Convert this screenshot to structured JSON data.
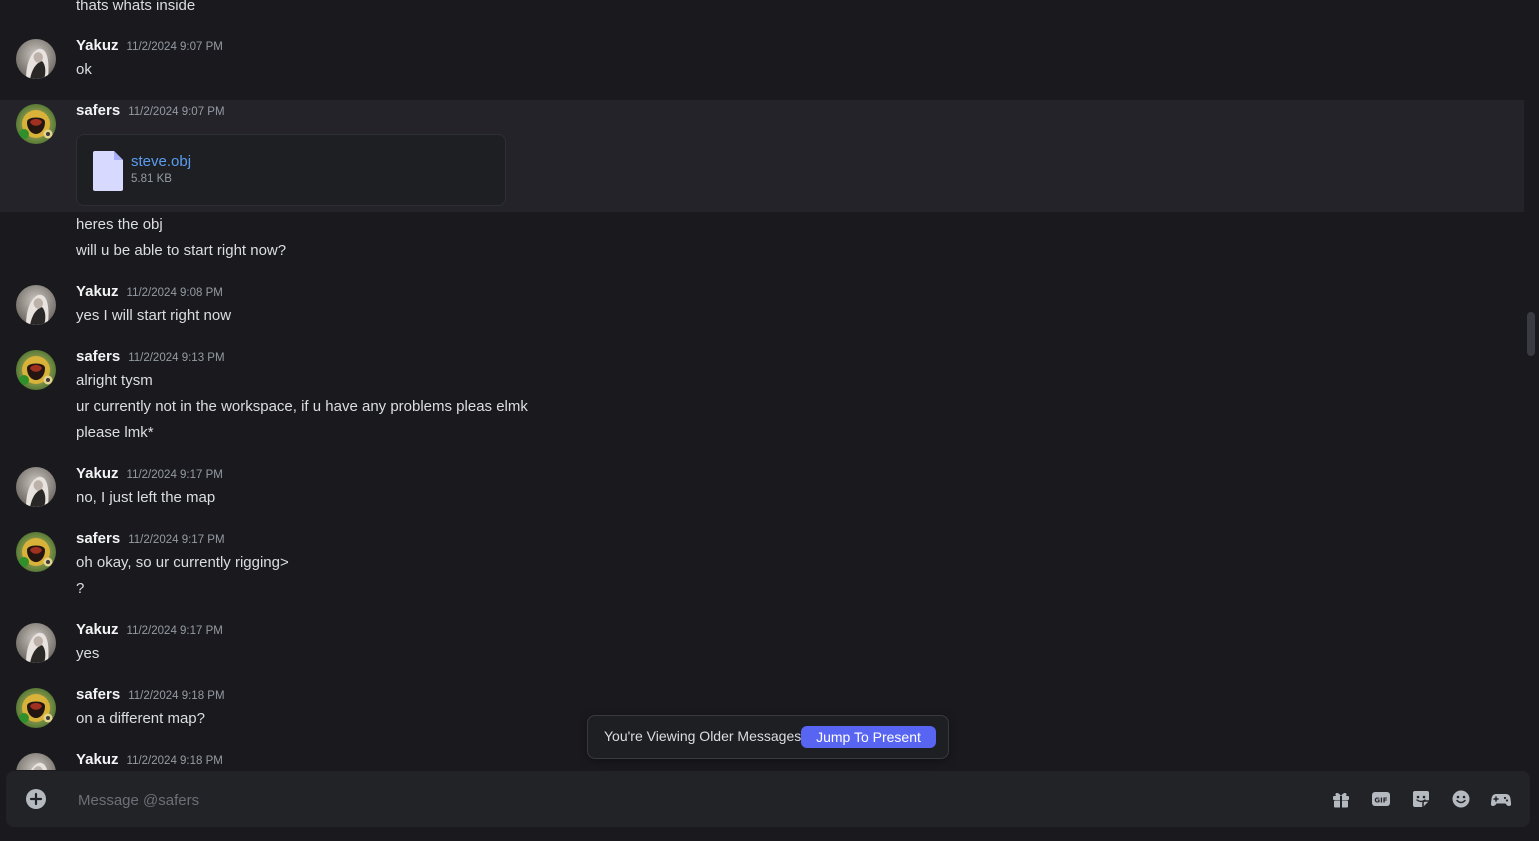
{
  "messages": {
    "m0": {
      "line1": "thats whats inside"
    },
    "m1": {
      "username": "Yakuz",
      "timestamp": "11/2/2024 9:07 PM",
      "line1": "ok"
    },
    "m2": {
      "username": "safers",
      "timestamp": "11/2/2024 9:07 PM",
      "attachment": {
        "name": "steve.obj",
        "size": "5.81 KB"
      },
      "line1": "heres the obj",
      "line2": "will u be able to start right now?"
    },
    "m3": {
      "username": "Yakuz",
      "timestamp": "11/2/2024 9:08 PM",
      "line1": "yes I will start right now"
    },
    "m4": {
      "username": "safers",
      "timestamp": "11/2/2024 9:13 PM",
      "line1": "alright tysm",
      "line2": "ur currently not in the workspace, if u have any problems pleas elmk",
      "line3": "please lmk*"
    },
    "m5": {
      "username": "Yakuz",
      "timestamp": "11/2/2024 9:17 PM",
      "line1": "no, I just left the map"
    },
    "m6": {
      "username": "safers",
      "timestamp": "11/2/2024 9:17 PM",
      "line1": "oh okay, so ur currently rigging>",
      "line2": "?"
    },
    "m7": {
      "username": "Yakuz",
      "timestamp": "11/2/2024 9:17 PM",
      "line1": "yes"
    },
    "m8": {
      "username": "safers",
      "timestamp": "11/2/2024 9:18 PM",
      "line1": "on a different map?"
    },
    "m9": {
      "username": "Yakuz",
      "timestamp": "11/2/2024 9:18 PM"
    }
  },
  "older_messages": {
    "text": "You're Viewing Older Messages",
    "jump_label": "Jump To Present"
  },
  "composer": {
    "placeholder": "Message @safers"
  },
  "icons": {
    "add": "plus-circle-icon",
    "gift": "gift-icon",
    "gif": "gif-icon",
    "sticker": "sticker-icon",
    "emoji": "emoji-icon",
    "activity": "gamepad-icon"
  },
  "colors": {
    "background": "#1a1a1e",
    "highlight": "#232329",
    "accent": "#5865f2",
    "link": "#5a9cf0"
  }
}
